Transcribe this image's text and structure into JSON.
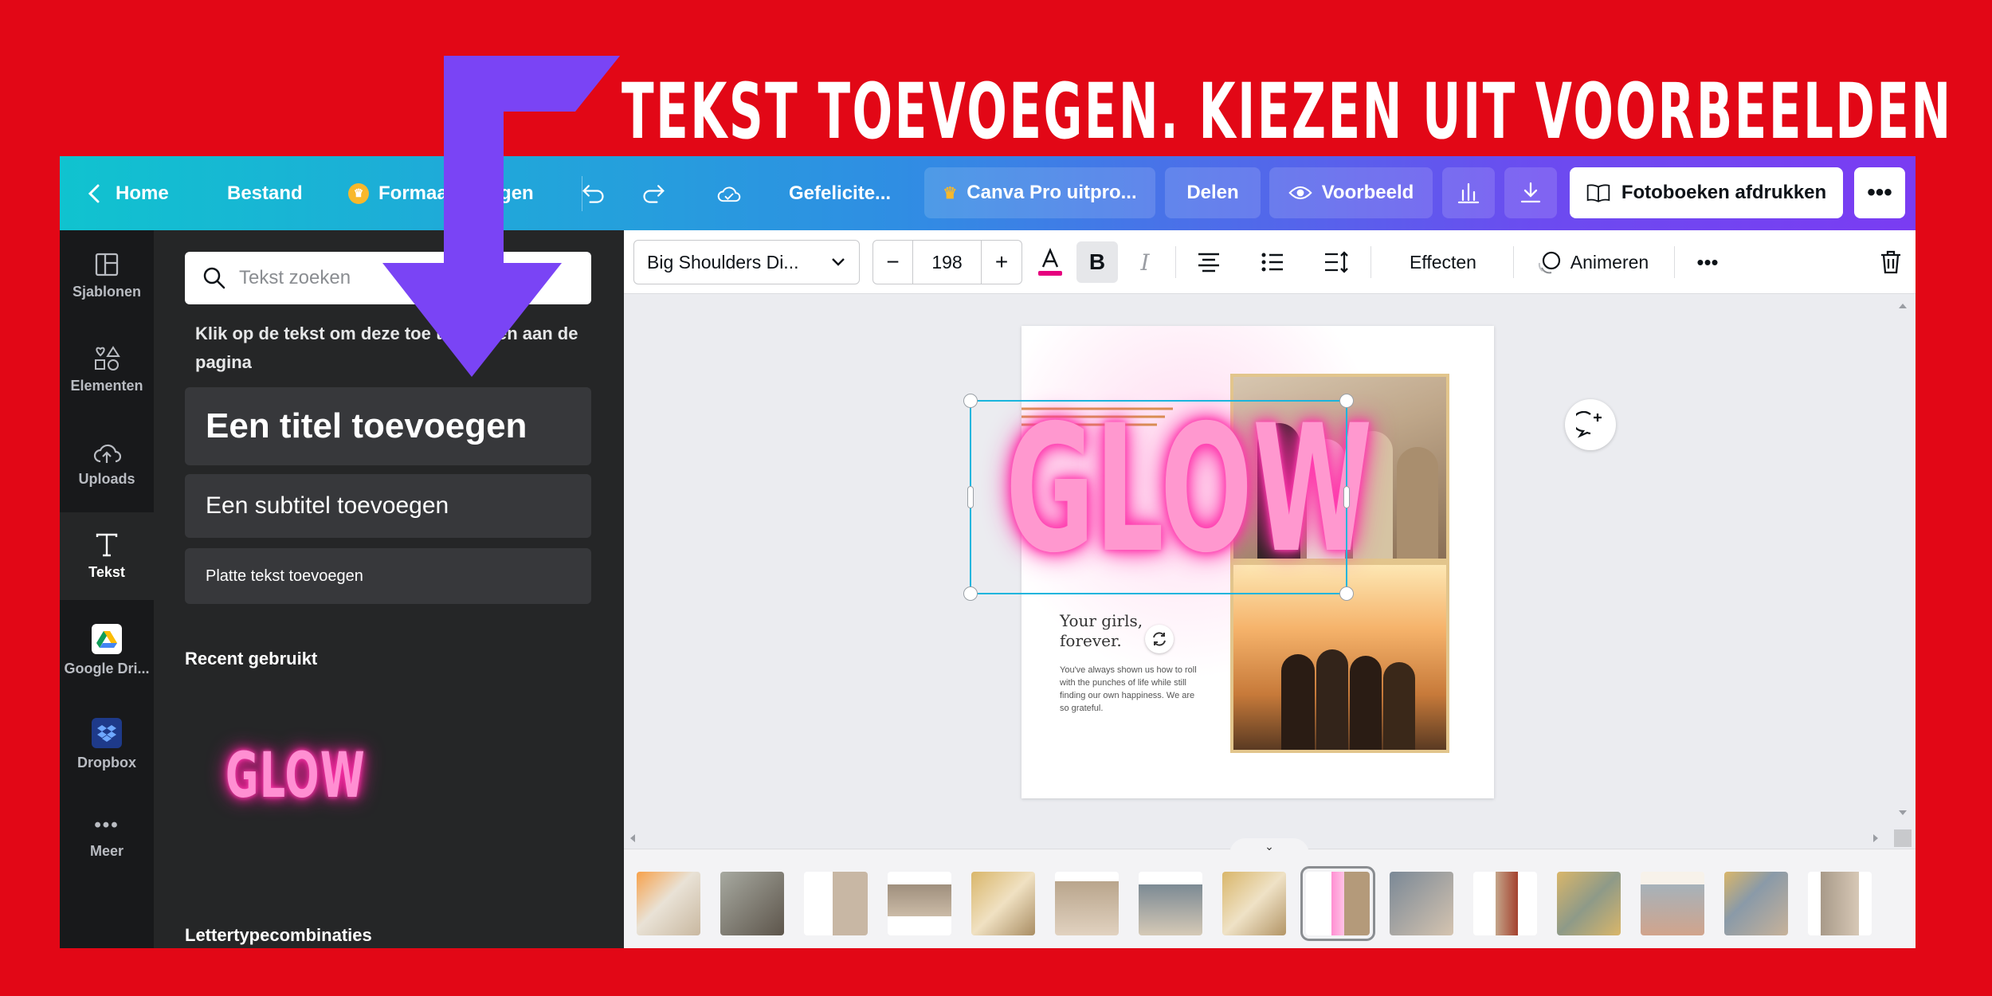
{
  "banner": {
    "title": "TEKST TOEVOEGEN. KIEZEN UIT VOORBEELDEN"
  },
  "topbar": {
    "home": "Home",
    "file": "Bestand",
    "resize": "Formaat wijzigen",
    "title": "Gefelicite...",
    "pro": "Canva Pro uitpro...",
    "share": "Delen",
    "preview": "Voorbeeld",
    "print": "Fotoboeken afdrukken"
  },
  "rail": {
    "items": [
      {
        "label": "Sjablonen",
        "icon": "layout-icon"
      },
      {
        "label": "Elementen",
        "icon": "shapes-icon"
      },
      {
        "label": "Uploads",
        "icon": "cloud-upload-icon"
      },
      {
        "label": "Tekst",
        "icon": "text-icon"
      },
      {
        "label": "Google Dri...",
        "icon": "google-drive-icon"
      },
      {
        "label": "Dropbox",
        "icon": "dropbox-icon"
      },
      {
        "label": "Meer",
        "icon": "more-icon"
      }
    ]
  },
  "panel": {
    "search_placeholder": "Tekst zoeken",
    "hint": "Klik op de tekst om deze toe te voegen aan de pagina",
    "add_title": "Een titel toevoegen",
    "add_subtitle": "Een subtitel toevoegen",
    "add_body": "Platte tekst toevoegen",
    "recent_heading": "Recent gebruikt",
    "recent_item": "GLOW",
    "combos_heading": "Lettertypecombinaties"
  },
  "format": {
    "font": "Big Shoulders Di...",
    "size": "198",
    "effects": "Effecten",
    "animate": "Animeren",
    "text_color": "#e6007e"
  },
  "canvas": {
    "headline": "GLOW",
    "subhead_line1": "Your girls,",
    "subhead_line2": "forever.",
    "body": "You've always shown us how to roll with the punches of life while still finding our own happiness. We are so grateful."
  },
  "colors": {
    "background": "#e20716",
    "arrow": "#7a44f5",
    "selection": "#19b5dd",
    "glow": "#ff2aa6"
  }
}
